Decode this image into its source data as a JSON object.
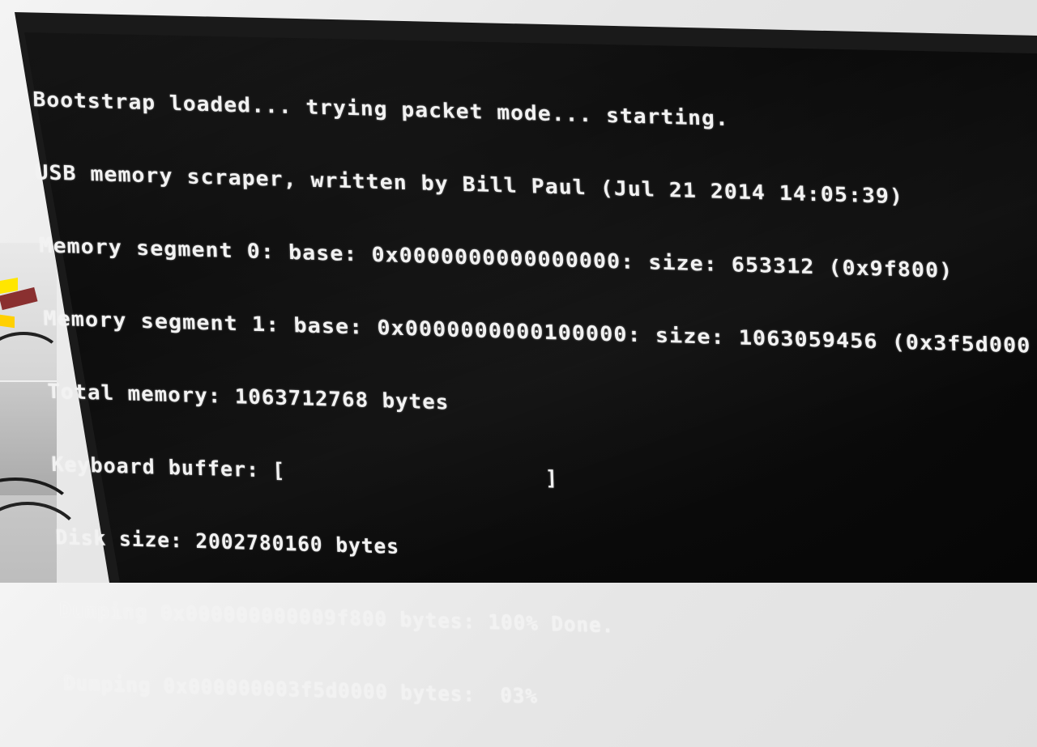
{
  "console": {
    "lines": [
      "Bootstrap loaded... trying packet mode... starting.",
      "USB memory scraper, written by Bill Paul (Jul 21 2014 14:05:39)",
      "Memory segment 0: base: 0x0000000000000000: size: 653312 (0x9f800)",
      "Memory segment 1: base: 0x0000000000100000: size: 1063059456 (0x3f5d000",
      "Total memory: 1063712768 bytes",
      "Keyboard buffer: [                    ]",
      "Disk size: 2002780160 bytes",
      "Dumping 0x000000000009f800 bytes: 100% Done.",
      "Dumping 0x000000003f5d0000 bytes:  03%"
    ]
  },
  "progress": {
    "dump_1_percent": 100,
    "dump_2_percent": 3
  },
  "colors": {
    "console_text": "#f2f2f2",
    "screen_background": "#0c0c0c",
    "bezel": "#1a1a1a"
  }
}
